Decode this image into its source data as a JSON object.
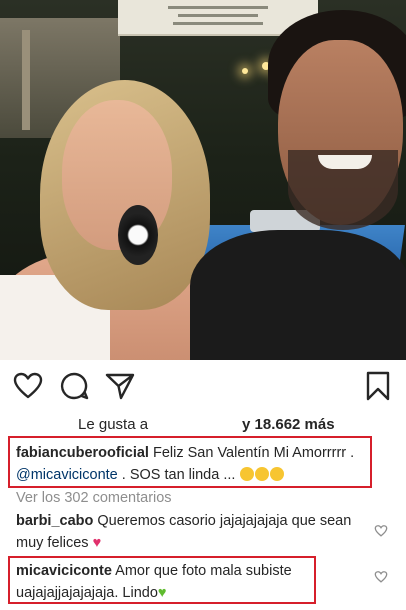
{
  "post": {
    "likes_prefix": "Le gusta a",
    "likes_count": "y 18.662 más",
    "caption": {
      "username": "fabiancuberooficial",
      "text_1": "Feliz San Valentín Mi Amorrrrr .",
      "mention": "@micaviciconte",
      "text_2": ". SOS tan linda ..."
    },
    "view_all_comments": "Ver los 302 comentarios",
    "comments": [
      {
        "username": "barbi_cabo",
        "text": "Queremos casorio jajajajajaja que sean muy felices",
        "heart": "♥"
      },
      {
        "username": "micaviciconte",
        "text": "Amor que foto mala subiste uajajajjajajajaja. Lindo",
        "heart": "♥"
      }
    ]
  },
  "icons": {
    "like": "heart-icon",
    "comment": "comment-icon",
    "share": "share-icon",
    "save": "bookmark-icon"
  },
  "colors": {
    "highlight_border": "#d61f2b",
    "mention": "#003569",
    "muted": "#8e8e8e",
    "pink_heart": "#e1306c",
    "green_heart": "#5fbb2f"
  }
}
